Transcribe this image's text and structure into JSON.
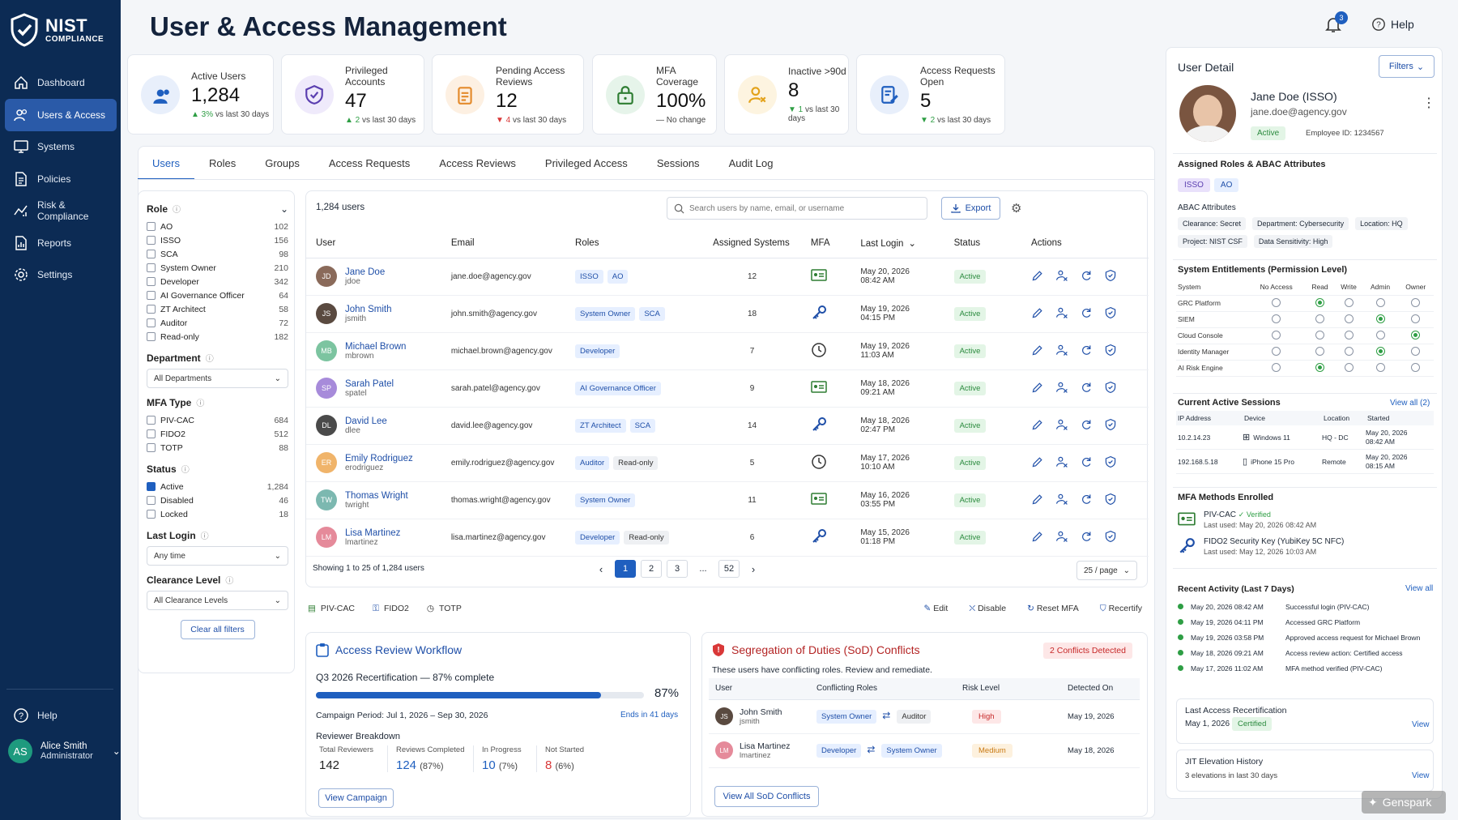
{
  "brand": {
    "title": "NIST",
    "subtitle": "COMPLIANCE"
  },
  "nav": [
    {
      "label": "Dashboard",
      "icon": "home-icon"
    },
    {
      "label": "Users & Access",
      "icon": "users-icon",
      "active": true
    },
    {
      "label": "Systems",
      "icon": "monitor-icon"
    },
    {
      "label": "Policies",
      "icon": "document-icon"
    },
    {
      "label": "Risk & Compliance",
      "icon": "chart-icon"
    },
    {
      "label": "Reports",
      "icon": "report-icon"
    },
    {
      "label": "Settings",
      "icon": "gear-icon"
    }
  ],
  "nav_help": "Help",
  "current_user": {
    "initials": "AS",
    "name": "Alice Smith",
    "role": "Administrator"
  },
  "page_title": "User & Access Management",
  "header": {
    "notif_count": "3",
    "help": "Help"
  },
  "stats": [
    {
      "label": "Active Users",
      "value": "1,284",
      "delta": "3%",
      "note": "vs last 30 days",
      "dir": "up"
    },
    {
      "label": "Privileged Accounts",
      "value": "47",
      "delta": "2",
      "note": "vs last 30 days",
      "dir": "up"
    },
    {
      "label": "Pending Access Reviews",
      "value": "12",
      "delta": "4",
      "note": "vs last 30 days",
      "dir": "down"
    },
    {
      "label": "MFA Coverage",
      "value": "100%",
      "delta": "—",
      "note": "No change",
      "dir": "flat"
    },
    {
      "label": "Inactive >90d",
      "value": "8",
      "delta": "1",
      "note": "vs last 30 days",
      "dir": "down"
    },
    {
      "label": "Access Requests Open",
      "value": "5",
      "delta": "2",
      "note": "vs last 30 days",
      "dir": "down"
    }
  ],
  "tabs": [
    "Users",
    "Roles",
    "Groups",
    "Access Requests",
    "Access Reviews",
    "Privileged Access",
    "Sessions",
    "Audit Log"
  ],
  "filters": {
    "role_title": "Role",
    "roles": [
      [
        "AO",
        "102"
      ],
      [
        "ISSO",
        "156"
      ],
      [
        "SCA",
        "98"
      ],
      [
        "System Owner",
        "210"
      ],
      [
        "Developer",
        "342"
      ],
      [
        "AI Governance Officer",
        "64"
      ],
      [
        "ZT Architect",
        "58"
      ],
      [
        "Auditor",
        "72"
      ],
      [
        "Read-only",
        "182"
      ]
    ],
    "dept_title": "Department",
    "dept_value": "All Departments",
    "mfa_title": "MFA Type",
    "mfa": [
      [
        "PIV-CAC",
        "684"
      ],
      [
        "FIDO2",
        "512"
      ],
      [
        "TOTP",
        "88"
      ]
    ],
    "status_title": "Status",
    "status": [
      [
        "Active",
        "1,284",
        true
      ],
      [
        "Disabled",
        "46",
        false
      ],
      [
        "Locked",
        "18",
        false
      ]
    ],
    "login_title": "Last Login",
    "login_value": "Any time",
    "clearance_title": "Clearance Level",
    "clearance_value": "All Clearance Levels",
    "clear_btn": "Clear all filters"
  },
  "users_table": {
    "count": "1,284 users",
    "search_placeholder": "Search users by name, email, or username",
    "export": "Export",
    "columns": [
      "User",
      "Email",
      "Roles",
      "Assigned Systems",
      "MFA",
      "Last Login",
      "Status",
      "Actions"
    ],
    "rows": [
      {
        "name": "Jane Doe",
        "user": "jdoe",
        "email": "jane.doe@agency.gov",
        "roles": [
          "ISSO",
          "AO"
        ],
        "systems": "12",
        "mfa": "piv",
        "date": "May 20, 2026",
        "time": "08:42 AM",
        "status": "Active",
        "av": "JD",
        "avc": "#8a6a5a"
      },
      {
        "name": "John Smith",
        "user": "jsmith",
        "email": "john.smith@agency.gov",
        "roles": [
          "System Owner",
          "SCA"
        ],
        "systems": "18",
        "mfa": "key",
        "date": "May 19, 2026",
        "time": "04:15 PM",
        "status": "Active",
        "av": "JS",
        "avc": "#5a4a40"
      },
      {
        "name": "Michael Brown",
        "user": "mbrown",
        "email": "michael.brown@agency.gov",
        "roles": [
          "Developer"
        ],
        "systems": "7",
        "mfa": "clock",
        "date": "May 19, 2026",
        "time": "11:03 AM",
        "status": "Active",
        "av": "MB",
        "avc": "#7cc4a0"
      },
      {
        "name": "Sarah Patel",
        "user": "spatel",
        "email": "sarah.patel@agency.gov",
        "roles": [
          "AI Governance Officer"
        ],
        "systems": "9",
        "mfa": "piv",
        "date": "May 18, 2026",
        "time": "09:21 AM",
        "status": "Active",
        "av": "SP",
        "avc": "#a78bda"
      },
      {
        "name": "David Lee",
        "user": "dlee",
        "email": "david.lee@agency.gov",
        "roles": [
          "ZT Architect",
          "SCA"
        ],
        "systems": "14",
        "mfa": "key",
        "date": "May 18, 2026",
        "time": "02:47 PM",
        "status": "Active",
        "av": "DL",
        "avc": "#4a4a4a"
      },
      {
        "name": "Emily Rodriguez",
        "user": "erodriguez",
        "email": "emily.rodriguez@agency.gov",
        "roles": [
          "Auditor",
          "Read-only"
        ],
        "systems": "5",
        "mfa": "clock",
        "date": "May 17, 2026",
        "time": "10:10 AM",
        "status": "Active",
        "av": "ER",
        "avc": "#f0b46a"
      },
      {
        "name": "Thomas Wright",
        "user": "twright",
        "email": "thomas.wright@agency.gov",
        "roles": [
          "System Owner"
        ],
        "systems": "11",
        "mfa": "piv",
        "date": "May 16, 2026",
        "time": "03:55 PM",
        "status": "Active",
        "av": "TW",
        "avc": "#7cb8b0"
      },
      {
        "name": "Lisa Martinez",
        "user": "lmartinez",
        "email": "lisa.martinez@agency.gov",
        "roles": [
          "Developer",
          "Read-only"
        ],
        "systems": "6",
        "mfa": "key",
        "date": "May 15, 2026",
        "time": "01:18 PM",
        "status": "Active",
        "av": "LM",
        "avc": "#e58a9a"
      }
    ],
    "showing": "Showing 1 to 25 of 1,284 users",
    "pages": [
      "1",
      "2",
      "3",
      "...",
      "52"
    ],
    "per_page": "25 / page",
    "legend": [
      "PIV-CAC",
      "FIDO2",
      "TOTP"
    ],
    "action_legend": [
      "Edit",
      "Disable",
      "Reset MFA",
      "Recertify"
    ]
  },
  "review": {
    "title": "Access Review Workflow",
    "campaign": "Q3 2026 Recertification — 87% complete",
    "pct": "87%",
    "progress": 0.87,
    "period": "Campaign Period: Jul 1, 2026 – Sep 30, 2026",
    "ends": "Ends in 41 days",
    "breakdown_title": "Reviewer Breakdown",
    "stats": [
      [
        "Total Reviewers",
        "142",
        ""
      ],
      [
        "Reviews Completed",
        "124",
        "(87%)"
      ],
      [
        "In Progress",
        "10",
        "(7%)"
      ],
      [
        "Not Started",
        "8",
        "(6%)"
      ]
    ],
    "btn": "View Campaign"
  },
  "sod": {
    "title": "Segregation of Duties (SoD) Conflicts",
    "badge": "2 Conflicts Detected",
    "desc": "These users have conflicting roles. Review and remediate.",
    "columns": [
      "User",
      "Conflicting Roles",
      "Risk Level",
      "Detected On"
    ],
    "rows": [
      {
        "name": "John Smith",
        "user": "jsmith",
        "r1": "System Owner",
        "r2": "Auditor",
        "risk": "High",
        "date": "May 19, 2026"
      },
      {
        "name": "Lisa Martinez",
        "user": "lmartinez",
        "r1": "Developer",
        "r2": "System Owner",
        "risk": "Medium",
        "date": "May 18, 2026"
      }
    ],
    "btn": "View All SoD Conflicts"
  },
  "detail": {
    "title": "User Detail",
    "filters": "Filters",
    "name": "Jane Doe (ISSO)",
    "email": "jane.doe@agency.gov",
    "status": "Active",
    "emp": "Employee ID: 1234567",
    "roles_title": "Assigned Roles & ABAC Attributes",
    "roles": [
      "ISSO",
      "AO"
    ],
    "abac_title": "ABAC Attributes",
    "abac": [
      "Clearance: Secret",
      "Department: Cybersecurity",
      "Location: HQ",
      "Project: NIST CSF",
      "Data Sensitivity: High"
    ],
    "ent_title": "System Entitlements (Permission Level)",
    "ent_cols": [
      "System",
      "No Access",
      "Read",
      "Write",
      "Admin",
      "Owner"
    ],
    "ent_rows": [
      [
        "GRC Platform",
        1
      ],
      [
        "SIEM",
        3
      ],
      [
        "Cloud Console",
        4
      ],
      [
        "Identity Manager",
        3
      ],
      [
        "AI Risk Engine",
        1
      ]
    ],
    "sess_title": "Current Active Sessions",
    "sess_link": "View all (2)",
    "sess_cols": [
      "IP Address",
      "Device",
      "Location",
      "Started"
    ],
    "sessions": [
      [
        "10.2.14.23",
        "Windows 11",
        "HQ - DC",
        "May 20, 2026",
        "08:42 AM"
      ],
      [
        "192.168.5.18",
        "iPhone 15 Pro",
        "Remote",
        "May 20, 2026",
        "08:15 AM"
      ]
    ],
    "mfa_title": "MFA Methods Enrolled",
    "mfa": [
      [
        "PIV-CAC",
        "✓ Verified",
        "Last used: May 20, 2026 08:42 AM"
      ],
      [
        "FIDO2 Security Key (YubiKey 5C NFC)",
        "",
        "Last used: May 12, 2026 10:03 AM"
      ]
    ],
    "act_title": "Recent Activity (Last 7 Days)",
    "act_link": "View all",
    "activity": [
      [
        "May 20, 2026 08:42 AM",
        "Successful login (PIV-CAC)"
      ],
      [
        "May 19, 2026 04:11 PM",
        "Accessed GRC Platform"
      ],
      [
        "May 19, 2026 03:58 PM",
        "Approved access request for Michael Brown"
      ],
      [
        "May 18, 2026 09:21 AM",
        "Access review action: Certified access"
      ],
      [
        "May 17, 2026 11:02 AM",
        "MFA method verified (PIV-CAC)"
      ]
    ],
    "recert_title": "Last Access Recertification",
    "recert_date": "May 1, 2026",
    "recert_status": "Certified",
    "view": "View",
    "jit_title": "JIT Elevation History",
    "jit_sub": "3 elevations in last 30 days"
  },
  "watermark": "Genspark"
}
